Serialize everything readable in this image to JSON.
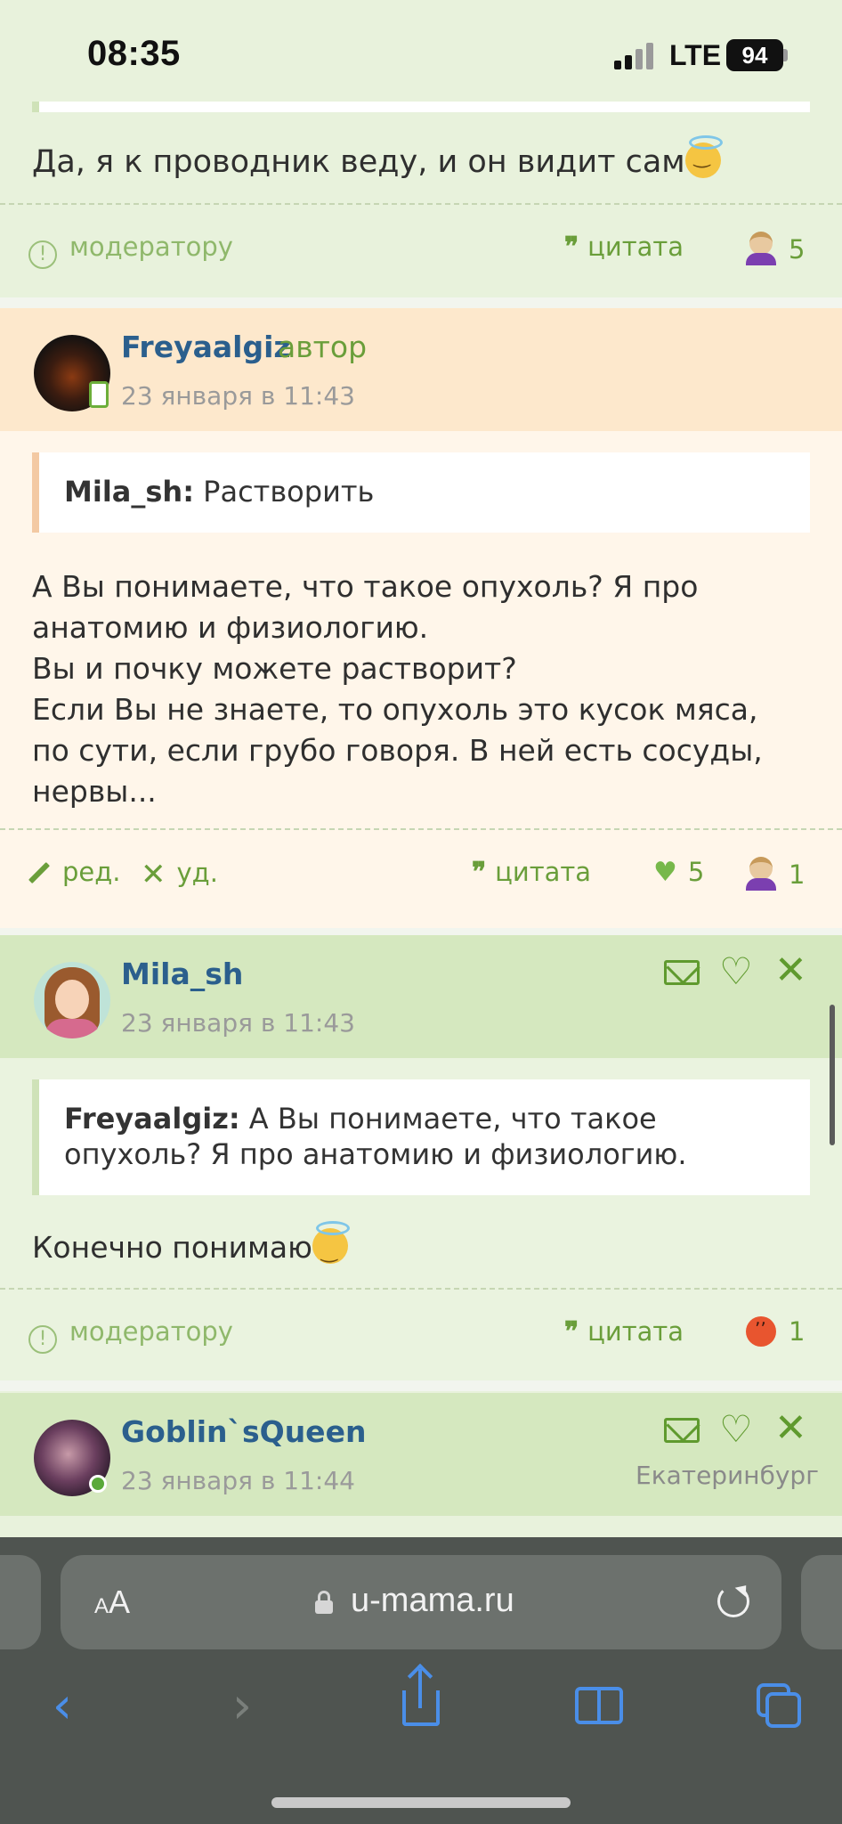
{
  "status_bar": {
    "time": "08:35",
    "network": "LTE",
    "battery": "94"
  },
  "post1": {
    "text": "Да, я к проводник веду, и он видит сам",
    "footer": {
      "report_label": "модератору",
      "quote_label": "цитата",
      "reaction_count": "5"
    }
  },
  "post2": {
    "username": "Freyaalgiz",
    "author_tag": "автор",
    "date": "23 января в 11:43",
    "quote": {
      "author": "Mila_sh:",
      "text": "Растворить"
    },
    "body_lines": [
      "А Вы понимаете, что такое опухоль? Я про",
      "анатомию и физиологию.",
      "Вы и почку можете растворит?",
      "Если Вы не знаете, то опухоль это кусок мяса,",
      "по сути, если грубо говоря. В ней есть сосуды,",
      "нервы..."
    ],
    "footer": {
      "edit_label": "ред.",
      "delete_label": "уд.",
      "quote_label": "цитата",
      "like_count": "5",
      "facepalm_count": "1"
    }
  },
  "post3": {
    "username": "Mila_sh",
    "date": "23 января в 11:43",
    "quote": {
      "author": "Freyaalgiz:",
      "line1": "А Вы понимаете, что такое",
      "line2": "опухоль? Я про анатомию и физиологию."
    },
    "text": "Конечно понимаю",
    "footer": {
      "report_label": "модератору",
      "quote_label": "цитата",
      "angry_count": "1"
    }
  },
  "post4": {
    "username": "Goblin`sQueen",
    "date": "23 января в 11:44",
    "city": "Екатеринбург"
  },
  "browser": {
    "font_size_label_small": "A",
    "font_size_label_big": "A",
    "url": "u-mama.ru"
  },
  "colors": {
    "accent_green": "#6a9e3a",
    "username_blue": "#2b5f8d",
    "safari_blue": "#4a8ee8"
  }
}
